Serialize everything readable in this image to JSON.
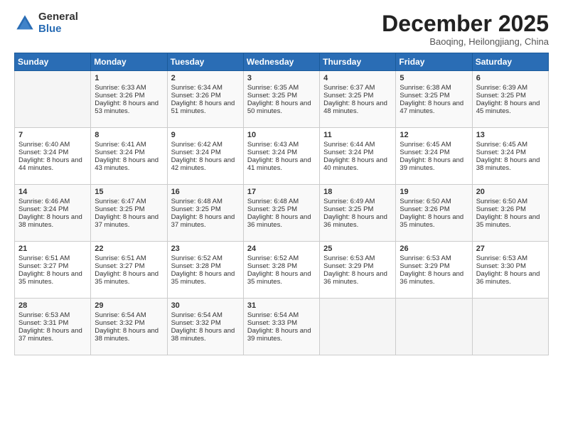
{
  "header": {
    "logo_general": "General",
    "logo_blue": "Blue",
    "month_title": "December 2025",
    "subtitle": "Baoqing, Heilongjiang, China"
  },
  "days_of_week": [
    "Sunday",
    "Monday",
    "Tuesday",
    "Wednesday",
    "Thursday",
    "Friday",
    "Saturday"
  ],
  "weeks": [
    [
      {
        "day": "",
        "sunrise": "",
        "sunset": "",
        "daylight": ""
      },
      {
        "day": "1",
        "sunrise": "Sunrise: 6:33 AM",
        "sunset": "Sunset: 3:26 PM",
        "daylight": "Daylight: 8 hours and 53 minutes."
      },
      {
        "day": "2",
        "sunrise": "Sunrise: 6:34 AM",
        "sunset": "Sunset: 3:26 PM",
        "daylight": "Daylight: 8 hours and 51 minutes."
      },
      {
        "day": "3",
        "sunrise": "Sunrise: 6:35 AM",
        "sunset": "Sunset: 3:25 PM",
        "daylight": "Daylight: 8 hours and 50 minutes."
      },
      {
        "day": "4",
        "sunrise": "Sunrise: 6:37 AM",
        "sunset": "Sunset: 3:25 PM",
        "daylight": "Daylight: 8 hours and 48 minutes."
      },
      {
        "day": "5",
        "sunrise": "Sunrise: 6:38 AM",
        "sunset": "Sunset: 3:25 PM",
        "daylight": "Daylight: 8 hours and 47 minutes."
      },
      {
        "day": "6",
        "sunrise": "Sunrise: 6:39 AM",
        "sunset": "Sunset: 3:25 PM",
        "daylight": "Daylight: 8 hours and 45 minutes."
      }
    ],
    [
      {
        "day": "7",
        "sunrise": "Sunrise: 6:40 AM",
        "sunset": "Sunset: 3:24 PM",
        "daylight": "Daylight: 8 hours and 44 minutes."
      },
      {
        "day": "8",
        "sunrise": "Sunrise: 6:41 AM",
        "sunset": "Sunset: 3:24 PM",
        "daylight": "Daylight: 8 hours and 43 minutes."
      },
      {
        "day": "9",
        "sunrise": "Sunrise: 6:42 AM",
        "sunset": "Sunset: 3:24 PM",
        "daylight": "Daylight: 8 hours and 42 minutes."
      },
      {
        "day": "10",
        "sunrise": "Sunrise: 6:43 AM",
        "sunset": "Sunset: 3:24 PM",
        "daylight": "Daylight: 8 hours and 41 minutes."
      },
      {
        "day": "11",
        "sunrise": "Sunrise: 6:44 AM",
        "sunset": "Sunset: 3:24 PM",
        "daylight": "Daylight: 8 hours and 40 minutes."
      },
      {
        "day": "12",
        "sunrise": "Sunrise: 6:45 AM",
        "sunset": "Sunset: 3:24 PM",
        "daylight": "Daylight: 8 hours and 39 minutes."
      },
      {
        "day": "13",
        "sunrise": "Sunrise: 6:45 AM",
        "sunset": "Sunset: 3:24 PM",
        "daylight": "Daylight: 8 hours and 38 minutes."
      }
    ],
    [
      {
        "day": "14",
        "sunrise": "Sunrise: 6:46 AM",
        "sunset": "Sunset: 3:24 PM",
        "daylight": "Daylight: 8 hours and 38 minutes."
      },
      {
        "day": "15",
        "sunrise": "Sunrise: 6:47 AM",
        "sunset": "Sunset: 3:25 PM",
        "daylight": "Daylight: 8 hours and 37 minutes."
      },
      {
        "day": "16",
        "sunrise": "Sunrise: 6:48 AM",
        "sunset": "Sunset: 3:25 PM",
        "daylight": "Daylight: 8 hours and 37 minutes."
      },
      {
        "day": "17",
        "sunrise": "Sunrise: 6:48 AM",
        "sunset": "Sunset: 3:25 PM",
        "daylight": "Daylight: 8 hours and 36 minutes."
      },
      {
        "day": "18",
        "sunrise": "Sunrise: 6:49 AM",
        "sunset": "Sunset: 3:25 PM",
        "daylight": "Daylight: 8 hours and 36 minutes."
      },
      {
        "day": "19",
        "sunrise": "Sunrise: 6:50 AM",
        "sunset": "Sunset: 3:26 PM",
        "daylight": "Daylight: 8 hours and 35 minutes."
      },
      {
        "day": "20",
        "sunrise": "Sunrise: 6:50 AM",
        "sunset": "Sunset: 3:26 PM",
        "daylight": "Daylight: 8 hours and 35 minutes."
      }
    ],
    [
      {
        "day": "21",
        "sunrise": "Sunrise: 6:51 AM",
        "sunset": "Sunset: 3:27 PM",
        "daylight": "Daylight: 8 hours and 35 minutes."
      },
      {
        "day": "22",
        "sunrise": "Sunrise: 6:51 AM",
        "sunset": "Sunset: 3:27 PM",
        "daylight": "Daylight: 8 hours and 35 minutes."
      },
      {
        "day": "23",
        "sunrise": "Sunrise: 6:52 AM",
        "sunset": "Sunset: 3:28 PM",
        "daylight": "Daylight: 8 hours and 35 minutes."
      },
      {
        "day": "24",
        "sunrise": "Sunrise: 6:52 AM",
        "sunset": "Sunset: 3:28 PM",
        "daylight": "Daylight: 8 hours and 35 minutes."
      },
      {
        "day": "25",
        "sunrise": "Sunrise: 6:53 AM",
        "sunset": "Sunset: 3:29 PM",
        "daylight": "Daylight: 8 hours and 36 minutes."
      },
      {
        "day": "26",
        "sunrise": "Sunrise: 6:53 AM",
        "sunset": "Sunset: 3:29 PM",
        "daylight": "Daylight: 8 hours and 36 minutes."
      },
      {
        "day": "27",
        "sunrise": "Sunrise: 6:53 AM",
        "sunset": "Sunset: 3:30 PM",
        "daylight": "Daylight: 8 hours and 36 minutes."
      }
    ],
    [
      {
        "day": "28",
        "sunrise": "Sunrise: 6:53 AM",
        "sunset": "Sunset: 3:31 PM",
        "daylight": "Daylight: 8 hours and 37 minutes."
      },
      {
        "day": "29",
        "sunrise": "Sunrise: 6:54 AM",
        "sunset": "Sunset: 3:32 PM",
        "daylight": "Daylight: 8 hours and 38 minutes."
      },
      {
        "day": "30",
        "sunrise": "Sunrise: 6:54 AM",
        "sunset": "Sunset: 3:32 PM",
        "daylight": "Daylight: 8 hours and 38 minutes."
      },
      {
        "day": "31",
        "sunrise": "Sunrise: 6:54 AM",
        "sunset": "Sunset: 3:33 PM",
        "daylight": "Daylight: 8 hours and 39 minutes."
      },
      {
        "day": "",
        "sunrise": "",
        "sunset": "",
        "daylight": ""
      },
      {
        "day": "",
        "sunrise": "",
        "sunset": "",
        "daylight": ""
      },
      {
        "day": "",
        "sunrise": "",
        "sunset": "",
        "daylight": ""
      }
    ]
  ]
}
